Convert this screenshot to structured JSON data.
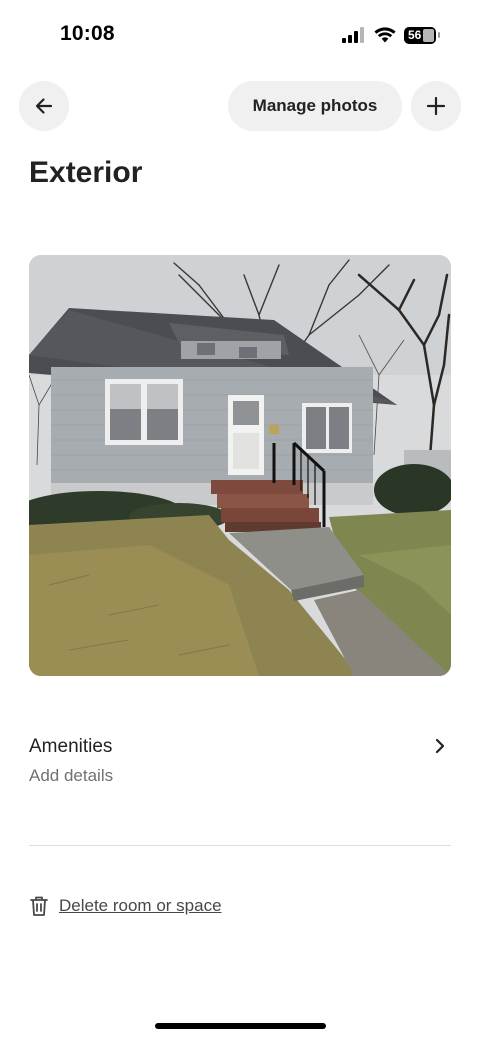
{
  "status": {
    "time": "10:08",
    "battery": "56",
    "icons": [
      "cellular-signal-icon",
      "wifi-icon",
      "battery-icon"
    ]
  },
  "nav": {
    "back_icon": "arrow-left-icon",
    "manage_label": "Manage photos",
    "add_icon": "plus-icon"
  },
  "page": {
    "title": "Exterior"
  },
  "photo": {
    "subject": "house-photo"
  },
  "amenities": {
    "title": "Amenities",
    "subtitle": "Add details",
    "icon": "chevron-right-icon"
  },
  "delete": {
    "label": "Delete room or space",
    "icon": "trash-icon"
  },
  "colors": {
    "text_primary": "#222222",
    "text_secondary": "#717171",
    "button_bg": "#f0f0f0",
    "divider": "#dddddd"
  }
}
